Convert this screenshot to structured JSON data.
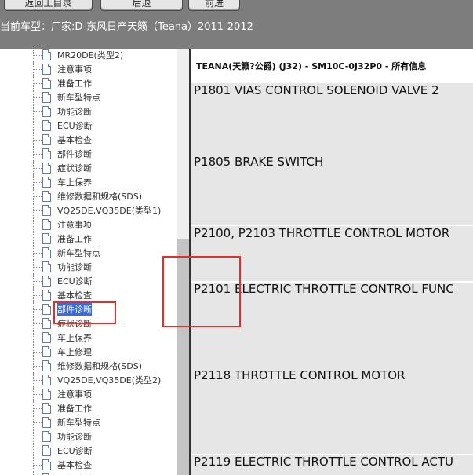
{
  "toolbar": {
    "buttons": [
      {
        "label": "返回上目录"
      },
      {
        "label": "后退"
      },
      {
        "label": "前进"
      }
    ]
  },
  "current_vehicle": {
    "label": "当前车型：",
    "value": "厂家:D-东风日产天籁（Teana）2011-2012"
  },
  "tree": {
    "items": [
      {
        "label": "MR20DE(类型2)"
      },
      {
        "label": "注意事项"
      },
      {
        "label": "准备工作"
      },
      {
        "label": "新车型特点"
      },
      {
        "label": "功能诊断"
      },
      {
        "label": "ECU诊断"
      },
      {
        "label": "基本检查"
      },
      {
        "label": "部件诊断"
      },
      {
        "label": "症状诊断"
      },
      {
        "label": "车上保养"
      },
      {
        "label": "维修数据和规格(SDS)"
      },
      {
        "label": "VQ25DE,VQ35DE(类型1)"
      },
      {
        "label": "注意事项"
      },
      {
        "label": "准备工作"
      },
      {
        "label": "新车型特点"
      },
      {
        "label": "功能诊断"
      },
      {
        "label": "ECU诊断"
      },
      {
        "label": "基本检查"
      },
      {
        "label": "部件诊断",
        "selected": true
      },
      {
        "label": "症状诊断"
      },
      {
        "label": "车上保养"
      },
      {
        "label": "车上修理"
      },
      {
        "label": "维修数据和规格(SDS)"
      },
      {
        "label": "VQ25DE,VQ35DE(类型2)"
      },
      {
        "label": "注意事项"
      },
      {
        "label": "准备工作"
      },
      {
        "label": "新车型特点"
      },
      {
        "label": "功能诊断"
      },
      {
        "label": "ECU诊断"
      },
      {
        "label": "基本检查"
      },
      {
        "label": "部件诊断"
      }
    ]
  },
  "content": {
    "header": "TEANA(天籁?公爵) (J32) - SM10C-0J32P0 - 所有信息",
    "items": [
      {
        "label": "P1801 VIAS CONTROL SOLENOID VALVE 2"
      },
      {
        "label": "P1805 BRAKE SWITCH"
      },
      {
        "label": "P2100, P2103 THROTTLE CONTROL MOTOR"
      },
      {
        "label": "P2101 ELECTRIC THROTTLE CONTROL FUNC"
      },
      {
        "label": "P2118 THROTTLE CONTROL MOTOR"
      },
      {
        "label": "P2119 ELECTRIC THROTTLE CONTROL ACTU"
      }
    ]
  },
  "colors": {
    "toolbar_bg": "#7d7d7d",
    "selection": "#3b6bd6",
    "annotation_red": "#e0302e",
    "content_bar": "#e6e6e6"
  }
}
